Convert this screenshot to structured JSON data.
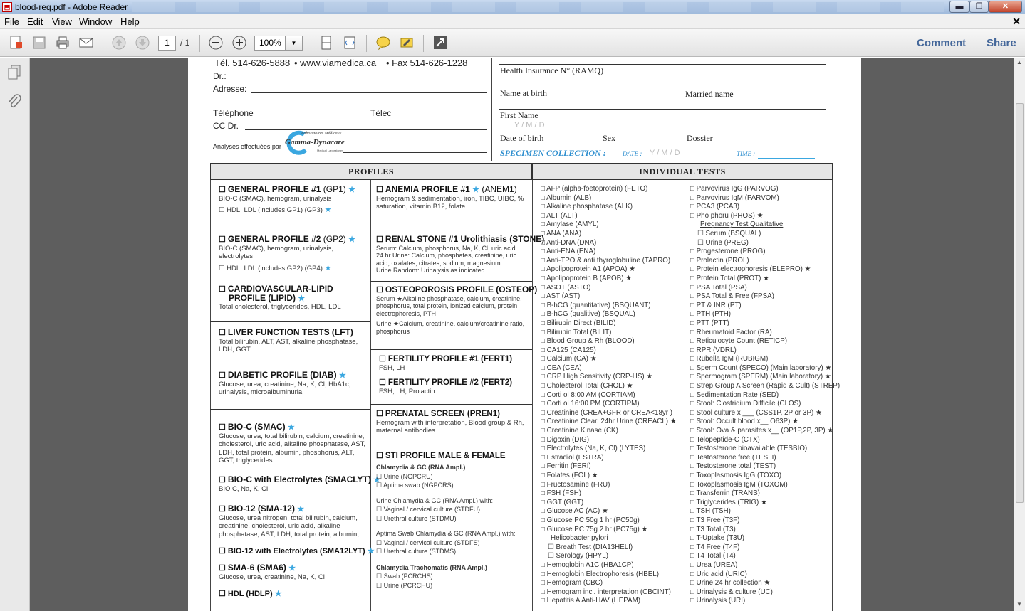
{
  "window": {
    "title": "blood-req.pdf - Adobe Reader",
    "min": "▬",
    "max": "❐",
    "close": "✕"
  },
  "menu": [
    "File",
    "Edit",
    "View",
    "Window",
    "Help"
  ],
  "toolbar": {
    "page_current": "1",
    "page_total": "/ 1",
    "zoom": "100%",
    "comment": "Comment",
    "share": "Share"
  },
  "doc": {
    "header": {
      "phone": "Tél. 514-626-5888",
      "web": "• www.viamedica.ca",
      "fax": "• Fax 514-626-1228",
      "dr": "Dr.:",
      "adresse": "Adresse:",
      "telephone": "Téléphone",
      "telec": "Télec",
      "ccdr": "CC Dr.",
      "analyses": "Analyses effectuées par",
      "lab_name": "Gamma-Dynacare",
      "lab_top": "Laboratoires Médicaux",
      "lab_bottom": "Medical Laboratories",
      "health_ins": "Health Insurance N° (RAMQ)",
      "name_birth": "Name at birth",
      "married": "Married name",
      "first_name": "First Name",
      "ymd": "Y   /   M   /   D",
      "dob": "Date of birth",
      "sex": "Sex",
      "dossier": "Dossier",
      "specimen": "SPECIMEN COLLECTION :",
      "date": "DATE :",
      "date_ymd": "Y    /   M    /   D",
      "time": "TIME :"
    },
    "profiles_header": "PROFILES",
    "individual_header": "INDIVIDUAL TESTS",
    "left_boxes": [
      {
        "title": "GENERAL PROFILE #1",
        "code": "(GP1)",
        "desc": "BIO-C (SMAC), hemogram, urinalysis",
        "opt": "☐ HDL, LDL (includes GP1)      (GP3)"
      },
      {
        "title": "GENERAL PROFILE #2",
        "code": "(GP2)",
        "desc": "BIO-C (SMAC), hemogram, urinalysis, electrolytes",
        "opt": "☐ HDL, LDL (includes GP2)      (GP4)"
      },
      {
        "title": "CARDIOVASCULAR-LIPID",
        "title2": "PROFILE (LIPID)",
        "desc": "Total cholesterol, triglycerides, HDL, LDL"
      },
      {
        "title": "LIVER FUNCTION TESTS (LFT)",
        "desc": "Total bilirubin, ALT, AST, alkaline phosphatase, LDH, GGT"
      },
      {
        "title": "DIABETIC PROFILE (DIAB)",
        "desc": "Glucose, urea, creatinine, Na, K, Cl, HbA1c, urinalysis, microalbuminuria"
      },
      {
        "title": "BIO-C (SMAC)",
        "desc": "Glucose, urea, total bilirubin, calcium, creatinine, cholesterol, uric acid, alkaline phosphatase, AST, LDH, total protein, albumin, phosphorus, ALT, GGT, triglycerides"
      },
      {
        "title": "BIO-C with Electrolytes (SMACLYT)",
        "desc": "BIO C, Na, K, Cl"
      },
      {
        "title": "BIO-12 (SMA-12)",
        "desc": "Glucose, urea nitrogen, total bilirubin, calcium, creatinine, cholesterol, uric acid, alkaline phosphatase, AST, LDH, total protein, albumin,"
      },
      {
        "title": "BIO-12 with Electrolytes (SMA12LYT)"
      },
      {
        "title": "SMA-6 (SMA6)",
        "desc": "Glucose, urea, creatinine, Na, K, Cl"
      },
      {
        "title": "HDL (HDLP)"
      }
    ],
    "mid_boxes": [
      {
        "title": "ANEMIA PROFILE #1",
        "code": "(ANEM1)",
        "desc": "Hemogram & sedimentation, iron, TIBC, UIBC, % saturation, vitamin B12, folate"
      },
      {
        "title": "RENAL STONE #1 Urolithiasis (STONE)",
        "l1": "Serum: Calcium, phosphorus, Na, K, Cl, uric acid",
        "l2": "24 hr Urine: Calcium, phosphates, creatinine, uric acid, oxalates, citrates, sodium, magnesium.",
        "l3": "Urine Random: Urinalysis as indicated"
      },
      {
        "title": "OSTEOPOROSIS PROFILE (OSTEOP)",
        "l1": "Serum ★Alkaline phosphatase, calcium, creatinine, phosphorus, total protein, ionized calcium, protein electrophoresis, PTH",
        "l2": "Urine ★Calcium, creatinine, calcium/creatinine ratio, phosphorus"
      },
      {
        "title": "FERTILITY PROFILE #1 (FERT1)",
        "desc": "FSH, LH"
      },
      {
        "title": "FERTILITY PROFILE #2 (FERT2)",
        "desc": "FSH, LH, Prolactin"
      },
      {
        "title": "PRENATAL SCREEN (PREN1)",
        "desc": "Hemogram with interpretation, Blood group & Rh, maternal antibodies"
      },
      {
        "title": "STI PROFILE MALE & FEMALE",
        "a": "Chlamydia & GC (RNA Ampl.)",
        "a1": "☐ Urine (NGPCRU)",
        "a2": "☐ Aptima swab (NGPCRS)",
        "b": "Urine Chlamydia & GC (RNA Ampl.) with:",
        "b1": "☐ Vaginal / cervical culture    (STDFU)",
        "b2": "☐ Urethral culture    (STDMU)",
        "c": "Aptima Swab Chlamydia & GC (RNA Ampl.) with:",
        "c1": "☐ Vaginal / cervical culture    (STDFS)",
        "c2": "☐ Urethral culture    (STDMS)",
        "d": "Chlamydia Trachomatis (RNA Ampl.)",
        "d1": "☐ Swab       (PCRCHS)",
        "d2": "☐ Urine       (PCRCHU)"
      }
    ],
    "tests_col1": [
      "AFP (alpha-foetoprotein) (FETO)",
      "Albumin (ALB)",
      "Alkaline phosphatase (ALK)",
      "ALT (ALT)",
      "Amylase (AMYL)",
      "ANA (ANA)",
      "Anti-DNA (DNA)",
      "Anti-ENA (ENA)",
      "Anti-TPO & anti thyroglobuline (TAPRO)",
      "Apolipoprotein A1 (APOA) ★",
      "Apolipoprotein B (APOB) ★",
      "ASOT (ASTO)",
      "AST (AST)",
      "B-hCG (quantitative) (BSQUANT)",
      "B-hCG (qualitive) (BSQUAL)",
      "Bilirubin Direct (BILID)",
      "Bilirubin Total (BILIT)",
      "Blood Group & Rh (BLOOD)",
      "CA125 (CA125)",
      "Calcium (CA) ★",
      "CEA (CEA)",
      "CRP High Sensitivity (CRP-HS) ★",
      "Cholesterol Total (CHOL) ★",
      "Corti ol 8:00 AM (CORTIAM)",
      "Corti ol 16:00 PM (CORTIPM)",
      "Creatinine (CREA+GFR or CREA<18yr )",
      "Creatinine Clear. 24hr Urine (CREACL) ★",
      "Creatinine Kinase (CK)",
      "Digoxin (DIG)",
      "Electrolytes (Na, K, Cl) (LYTES)",
      "Estradiol (ESTRA)",
      "Ferritin (FERI)",
      "Folates (FOL) ★",
      "Fructosamine (FRU)",
      "FSH (FSH)",
      "GGT (GGT)",
      "Glucose AC (AC) ★",
      "Glucose PC 50g 1 hr (PC50g)",
      "Glucose PC 75g 2 hr (PC75g) ★",
      "Helicobacter pylori",
      "☐ Breath Test (DIA13HELI)",
      "☐ Serology    (HPYL)",
      "Hemoglobin A1C (HBA1CP)",
      "Hemoglobin Electrophoresis (HBEL)",
      "Hemogram (CBC)",
      "Hemogram incl. interpretation (CBCINT)",
      "Hepatitis A Anti-HAV (HEPAM)"
    ],
    "tests_col2": [
      "Parvovirus IgG (PARVOG)",
      "Parvovirus IgM (PARVOM)",
      "PCA3 (PCA3)",
      "Pho phoru (PHOS) ★",
      "Pregnancy Test Qualitative",
      "☐ Serum (BSQUAL)",
      "☐ Urine (PREG)",
      "Progesterone (PROG)",
      "Prolactin (PROL)",
      "Protein electrophoresis (ELEPRO) ★",
      "Protein Total (PROT) ★",
      "PSA Total (PSA)",
      "PSA Total & Free (FPSA)",
      "PT & INR (PT)",
      "PTH (PTH)",
      "PTT (PTT)",
      "Rheumatoid Factor (RA)",
      "Reticulocyte Count (RETICP)",
      "RPR (VDRL)",
      "Rubella IgM (RUBIGM)",
      "Sperm Count (SPECO) (Main laboratory) ★",
      "Spermogram (SPERM) (Main laboratory) ★",
      "Strep Group A Screen (Rapid & Cult) (STREP)",
      "Sedimentation Rate (SED)",
      "Stool: Clostridium Difficile (CLOS)",
      "Stool culture x ___ (CSS1P, 2P or 3P) ★",
      "Stool: Occult blood x__ O63P) ★",
      "Stool: Ova & parasites x__ (OP1P,2P, 3P) ★",
      "Telopeptide-C (CTX)",
      "Testosterone bioavailable (TESBIO)",
      "Testosterone free (TESLI)",
      "Testosterone total (TEST)",
      "Toxoplasmosis IgG (TOXO)",
      "Toxoplasmosis IgM (TOXOM)",
      "Transferrin (TRANS)",
      "Triglycerides (TRIG) ★",
      "TSH (TSH)",
      "T3 Free (T3F)",
      "T3 Total (T3)",
      "T-Uptake (T3U)",
      "T4 Free (T4F)",
      "T4 Total (T4)",
      "Urea (UREA)",
      "Uric acid (URIC)",
      "Urine 24 hr collection ★",
      "Urinalysis & culture (UC)",
      "Urinalysis (URI)"
    ]
  }
}
